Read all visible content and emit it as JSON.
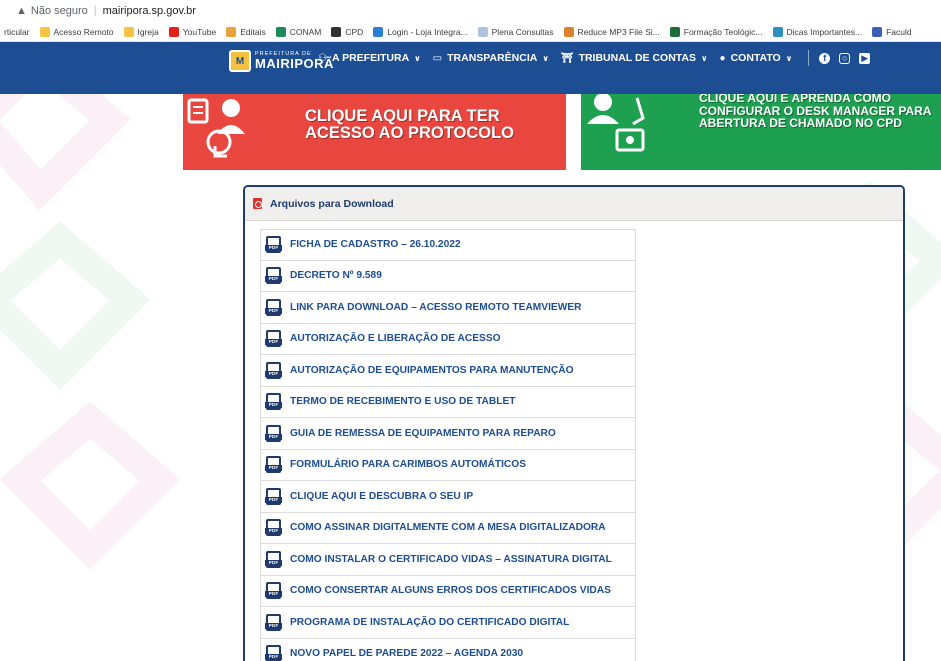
{
  "browser": {
    "security_label": "Não seguro",
    "url": "mairipora.sp.gov.br",
    "bookmarks": [
      {
        "label": "rticular",
        "color": "#ffffff"
      },
      {
        "label": "Acesso Remoto",
        "color": "#f6c343"
      },
      {
        "label": "Igreja",
        "color": "#f6c343"
      },
      {
        "label": "YouTube",
        "color": "#e62117"
      },
      {
        "label": "Editais",
        "color": "#e8a43c"
      },
      {
        "label": "CONAM",
        "color": "#1c8a5a"
      },
      {
        "label": "CPD",
        "color": "#333333"
      },
      {
        "label": "Login - Loja Integra...",
        "color": "#2a7fd4"
      },
      {
        "label": "Plena Consultas",
        "color": "#b0c4de"
      },
      {
        "label": "Reduce MP3 File Si...",
        "color": "#d9822b"
      },
      {
        "label": "Formação Teológic...",
        "color": "#1e6b3a"
      },
      {
        "label": "Dicas Importantes...",
        "color": "#2b8fbf"
      },
      {
        "label": "Faculd",
        "color": "#3a5fb8"
      }
    ]
  },
  "site": {
    "logo_top": "PREFEITURA DE",
    "logo_main": "MAIRIPORÃ",
    "nav": [
      {
        "label": "A PREFEITURA",
        "icon": "users-icon"
      },
      {
        "label": "TRANSPARÊNCIA",
        "icon": "monitor-icon"
      },
      {
        "label": "TRIBUNAL DE CONTAS",
        "icon": "bank-icon"
      },
      {
        "label": "CONTATO",
        "icon": "chat-icon"
      }
    ],
    "social": [
      "facebook-icon",
      "instagram-icon",
      "youtube-icon"
    ]
  },
  "banners": {
    "protocol": "CLIQUE AQUI PARA TER ACESSO AO PROTOCOLO",
    "desk": "CLIQUE AQUI E APRENDA COMO CONFIGURAR O DESK MANAGER PARA ABERTURA DE CHAMADO NO CPD"
  },
  "downloads": {
    "title": "Arquivos para Download",
    "file_tag": "PDF",
    "items": [
      "FICHA DE CADASTRO – 26.10.2022",
      "DECRETO Nº 9.589",
      "LINK PARA DOWNLOAD – ACESSO REMOTO TEAMVIEWER",
      "AUTORIZAÇÃO E LIBERAÇÃO DE ACESSO",
      "AUTORIZAÇÃO DE EQUIPAMENTOS PARA MANUTENÇÃO",
      "TERMO DE RECEBIMENTO E USO DE TABLET",
      "GUIA DE REMESSA DE EQUIPAMENTO PARA REPARO",
      "FORMULÁRIO PARA CARIMBOS AUTOMÁTICOS",
      "CLIQUE AQUI E DESCUBRA O SEU IP",
      "COMO ASSINAR DIGITALMENTE COM A MESA DIGITALIZADORA",
      "COMO INSTALAR O CERTIFICADO VIDAS – ASSINATURA DIGITAL",
      "COMO CONSERTAR ALGUNS ERROS DOS CERTIFICADOS VIDAS",
      "PROGRAMA DE INSTALAÇÃO DO CERTIFICADO DIGITAL",
      "NOVO PAPEL DE PAREDE 2022 – AGENDA 2030"
    ]
  },
  "colors": {
    "nav": "#1d4e93",
    "banner_red": "#e8463f",
    "banner_green": "#1da150",
    "link": "#1d4e93"
  }
}
